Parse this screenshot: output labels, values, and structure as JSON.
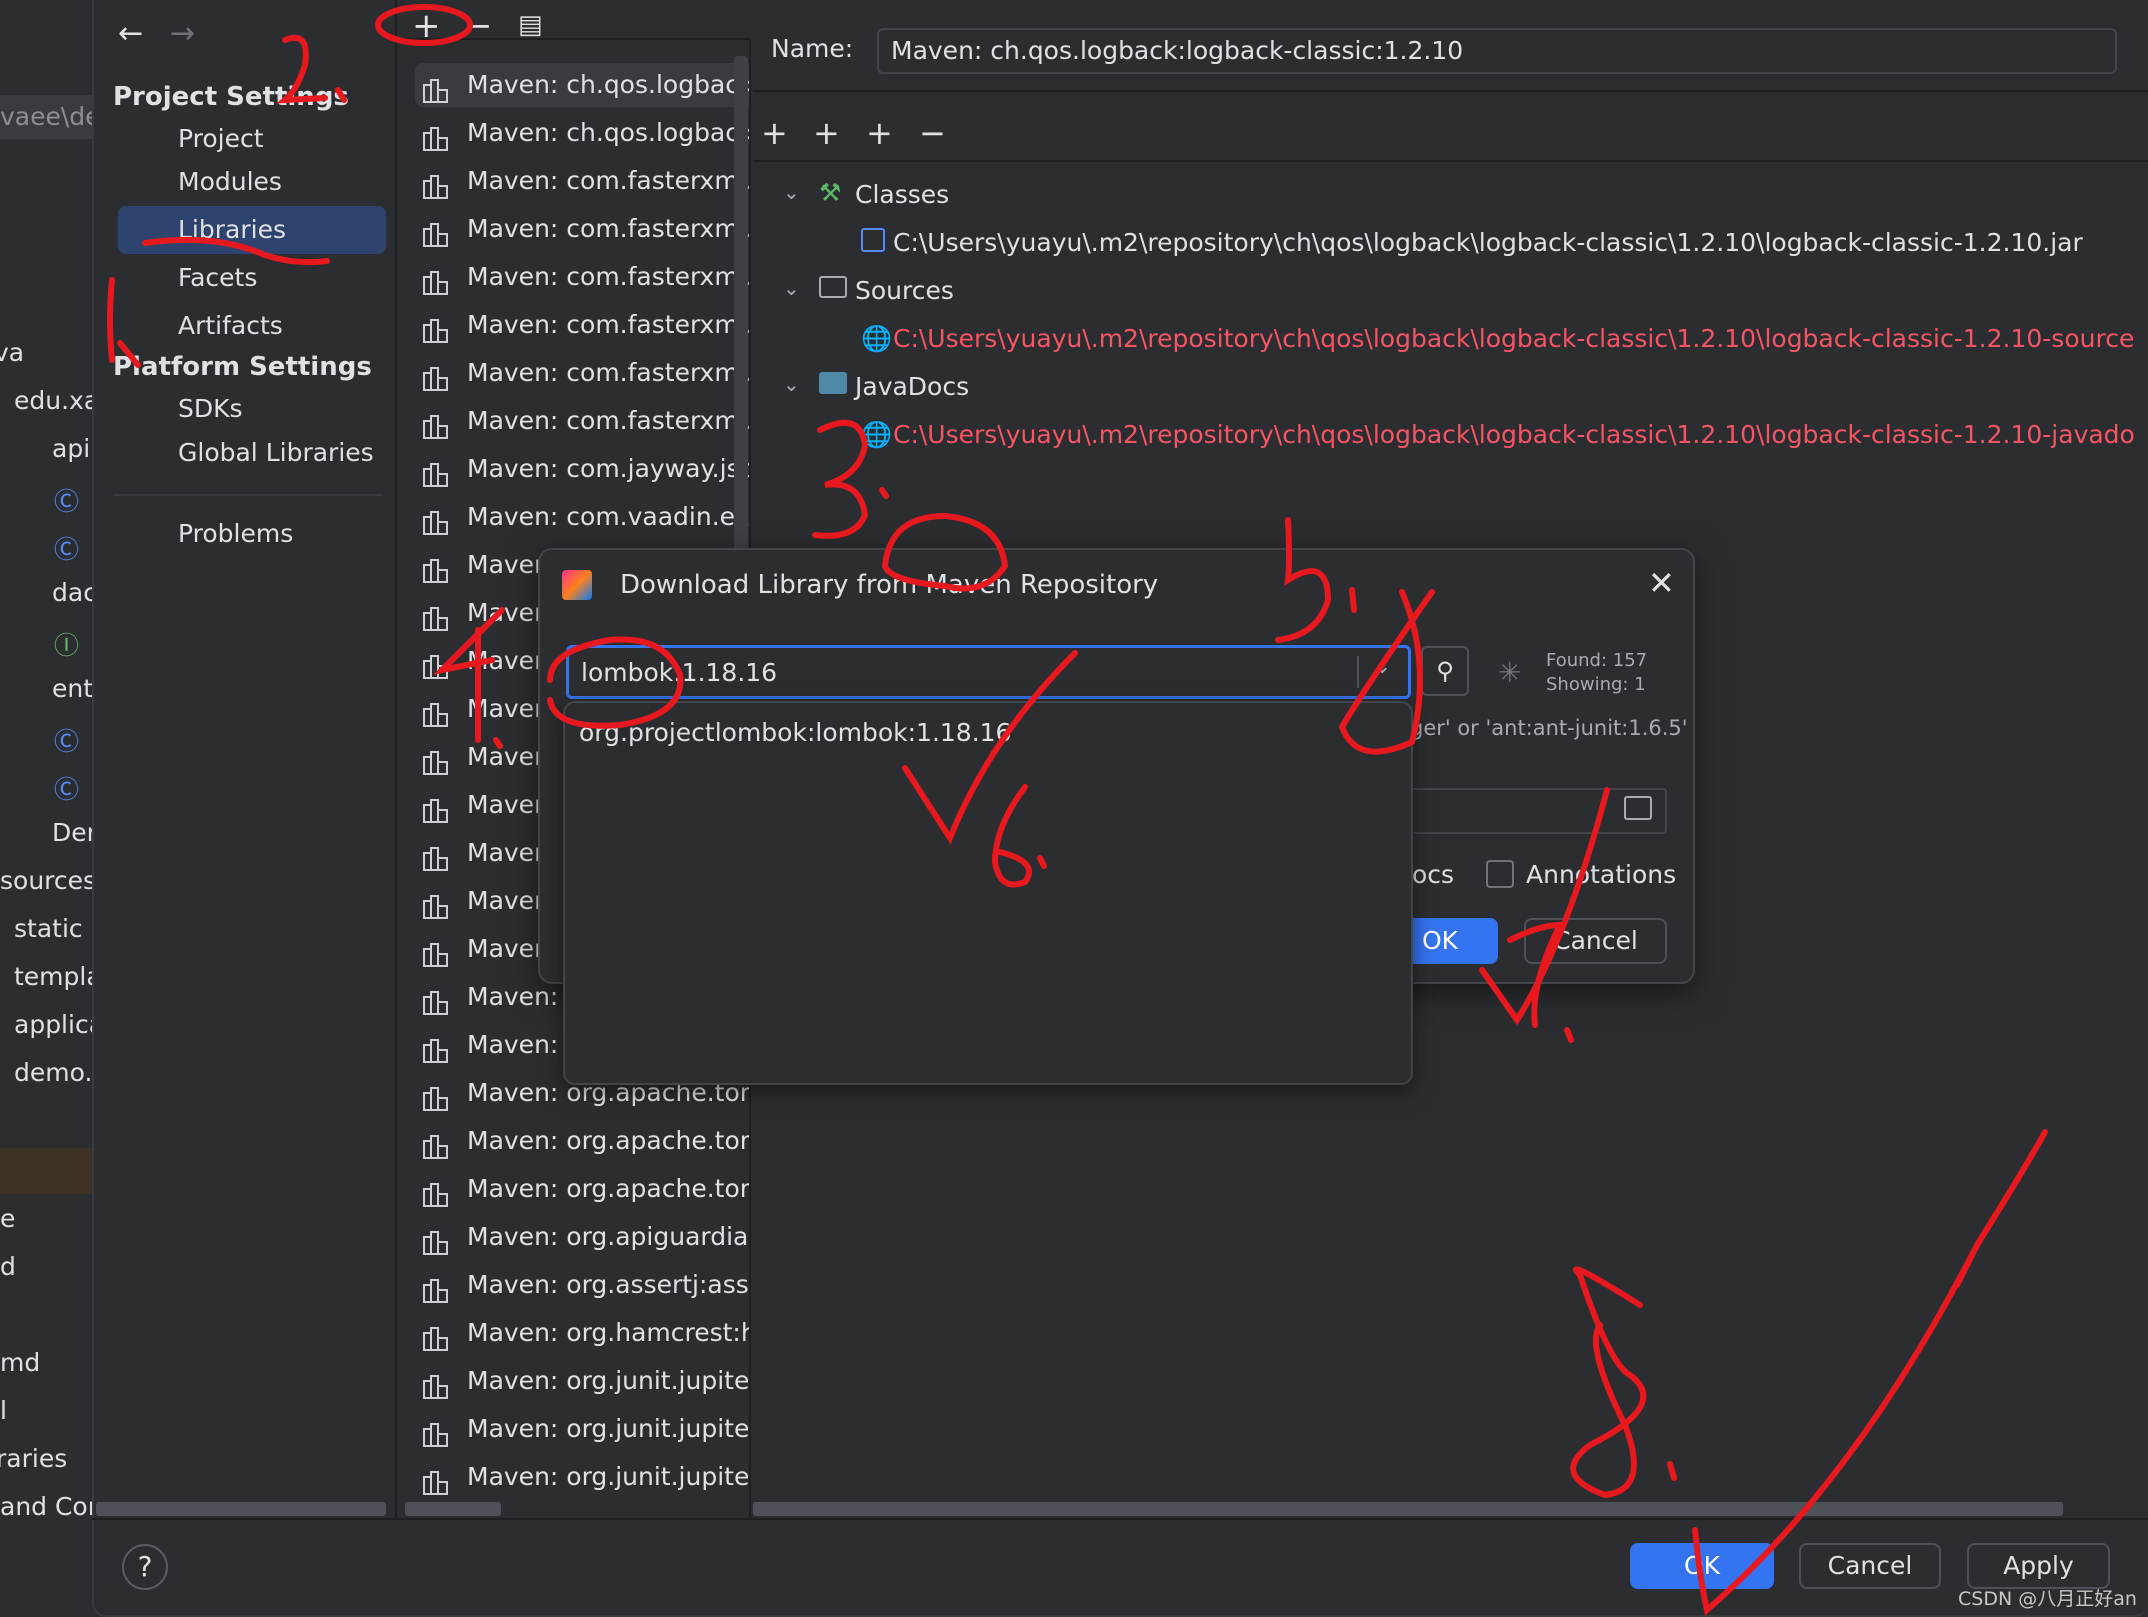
{
  "project_tree": {
    "items": [
      "vaee\\de",
      "va",
      "edu.xa",
      "api",
      "dac",
      "ent",
      "Der",
      "sources",
      "static",
      "templa",
      "applica",
      "demo.",
      "e",
      "d",
      "md",
      "l",
      "raries",
      "and Cor"
    ]
  },
  "sidebar": {
    "project_settings": "Project Settings",
    "project_items": [
      "Project",
      "Modules",
      "Libraries",
      "Facets",
      "Artifacts"
    ],
    "platform_settings": "Platform Settings",
    "platform_items": [
      "SDKs",
      "Global Libraries"
    ],
    "problems": "Problems",
    "selected": "Libraries"
  },
  "libraries": [
    "Maven: ch.qos.logback",
    "Maven: ch.qos.logback",
    "Maven: com.fasterxml.j",
    "Maven: com.fasterxml.j",
    "Maven: com.fasterxml.j",
    "Maven: com.fasterxml.j",
    "Maven: com.fasterxml.j",
    "Maven: com.fasterxml.j",
    "Maven: com.jayway.jso",
    "Maven: com.vaadin.ext",
    "Maven",
    "Maven",
    "Maven",
    "Maven",
    "Maven",
    "Maven",
    "Maven",
    "Maven",
    "Maven",
    "Maven:",
    "Maven:",
    "Maven: org.apache.tom",
    "Maven: org.apache.tom",
    "Maven: org.apache.tom",
    "Maven: org.apiguardian",
    "Maven: org.assertj:asse",
    "Maven: org.hamcrest:h",
    "Maven: org.junit.jupiter",
    "Maven: org.junit.jupiter",
    "Maven: org.junit.jupiter"
  ],
  "detail": {
    "name_label": "Name:",
    "name_value": "Maven: ch.qos.logback:logback-classic:1.2.10",
    "classes": "Classes",
    "classes_path": "C:\\Users\\yuayu\\.m2\\repository\\ch\\qos\\logback\\logback-classic\\1.2.10\\logback-classic-1.2.10.jar",
    "sources": "Sources",
    "sources_path": "C:\\Users\\yuayu\\.m2\\repository\\ch\\qos\\logback\\logback-classic\\1.2.10\\logback-classic-1.2.10-source",
    "javadocs": "JavaDocs",
    "javadocs_path": "C:\\Users\\yuayu\\.m2\\repository\\ch\\qos\\logback\\logback-classic\\1.2.10\\logback-classic-1.2.10-javado"
  },
  "dialog": {
    "title": "Download Library from Maven Repository",
    "search_value": "lombok:1.18.16",
    "found": "Found: 157",
    "showing": "Showing: 1",
    "hint_fragment": "ger' or 'ant:ant-junit:1.6.5'",
    "docs_fragment": "ocs",
    "annotations_label": "Annotations",
    "annotations_checked": false,
    "ok": "OK",
    "cancel": "Cancel",
    "suggestions": [
      "org.projectlombok:lombok:1.18.16"
    ]
  },
  "footer": {
    "help": "?",
    "ok": "OK",
    "cancel": "Cancel",
    "apply": "Apply"
  },
  "watermark": "CSDN @八月正好an",
  "colors": {
    "accent": "#3574f0",
    "selection": "#2e436e",
    "missing_path": "#f75464",
    "annotation": "#e8191e"
  }
}
